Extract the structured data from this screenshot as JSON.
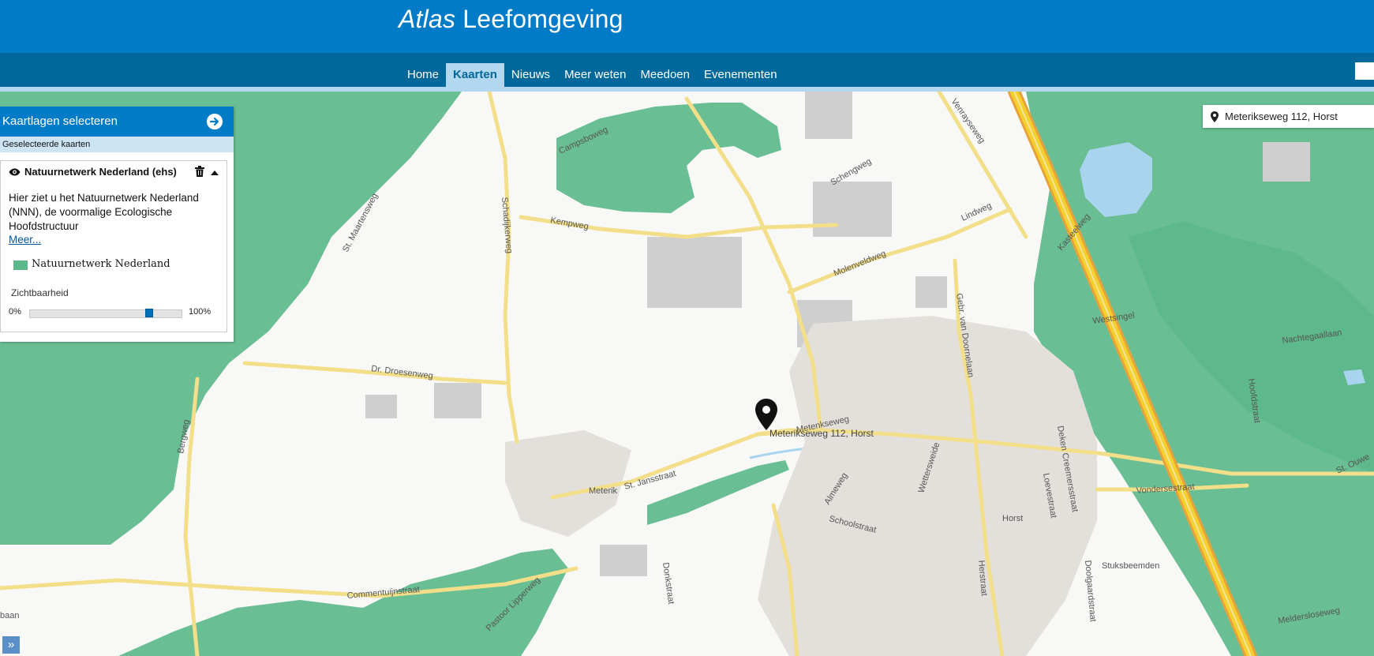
{
  "header": {
    "brand_italic": "Atlas",
    "brand_rest": " Leefomgeving"
  },
  "nav": {
    "items": [
      {
        "label": "Home",
        "active": false
      },
      {
        "label": "Kaarten",
        "active": true
      },
      {
        "label": "Nieuws",
        "active": false
      },
      {
        "label": "Meer weten",
        "active": false
      },
      {
        "label": "Meedoen",
        "active": false
      },
      {
        "label": "Evenementen",
        "active": false
      }
    ]
  },
  "address": {
    "label": "Meterikseweg 112, Horst",
    "pin_label": "Meterikseweg 112, Horst"
  },
  "panel": {
    "title": "Kaartlagen selecteren",
    "subheader": "Geselecteerde kaarten",
    "layer": {
      "name": "Natuurnetwerk Nederland (ehs)",
      "description": "Hier ziet u het Natuurnetwerk Nederland (NNN), de voormalige Ecologische Hoofdstructuur",
      "more_link": "Meer...",
      "legend_label": "Natuurnetwerk Nederland",
      "legend_color": "#5cb88a"
    },
    "visibility": {
      "label": "Zichtbaarheid",
      "min_label": "0%",
      "max_label": "100%",
      "value_percent": 80
    }
  },
  "sidebar_toggle": "»",
  "map": {
    "nature_color": "#5cb88a",
    "road_color": "#f7e7a1",
    "highway_color": "#f3c623",
    "labels": [
      {
        "text": "Campsboweg"
      },
      {
        "text": "Kempweg"
      },
      {
        "text": "Schadijkerweg"
      },
      {
        "text": "St. Maartensweg"
      },
      {
        "text": "Schengweg"
      },
      {
        "text": "Lindweg"
      },
      {
        "text": "Venrayseweg"
      },
      {
        "text": "Molenveldweg"
      },
      {
        "text": "Gebr. van Doornelaan"
      },
      {
        "text": "Dr. Droesenweg"
      },
      {
        "text": "Bergweg"
      },
      {
        "text": "Metenkseweg"
      },
      {
        "text": "Meterik"
      },
      {
        "text": "St. Jansstraat"
      },
      {
        "text": "Almeweg"
      },
      {
        "text": "Schoolstraat"
      },
      {
        "text": "Wettersweide"
      },
      {
        "text": "Deken Creemersstraat"
      },
      {
        "text": "Loevestraat"
      },
      {
        "text": "Horst"
      },
      {
        "text": "Vondersestraat"
      },
      {
        "text": "Nachtegaallaan"
      },
      {
        "text": "Stuksbeemden"
      },
      {
        "text": "Herstraat"
      },
      {
        "text": "Doolgaardstraat"
      },
      {
        "text": "Commentuijnstraat"
      },
      {
        "text": "Pastoor Lipperweg"
      },
      {
        "text": "Donkstraat"
      },
      {
        "text": "Meldersloseweg"
      },
      {
        "text": "St. Ouwe"
      },
      {
        "text": "Kasteelweg"
      },
      {
        "text": "Westsingel"
      },
      {
        "text": "Hoofdstraat"
      },
      {
        "text": "baan"
      }
    ]
  }
}
